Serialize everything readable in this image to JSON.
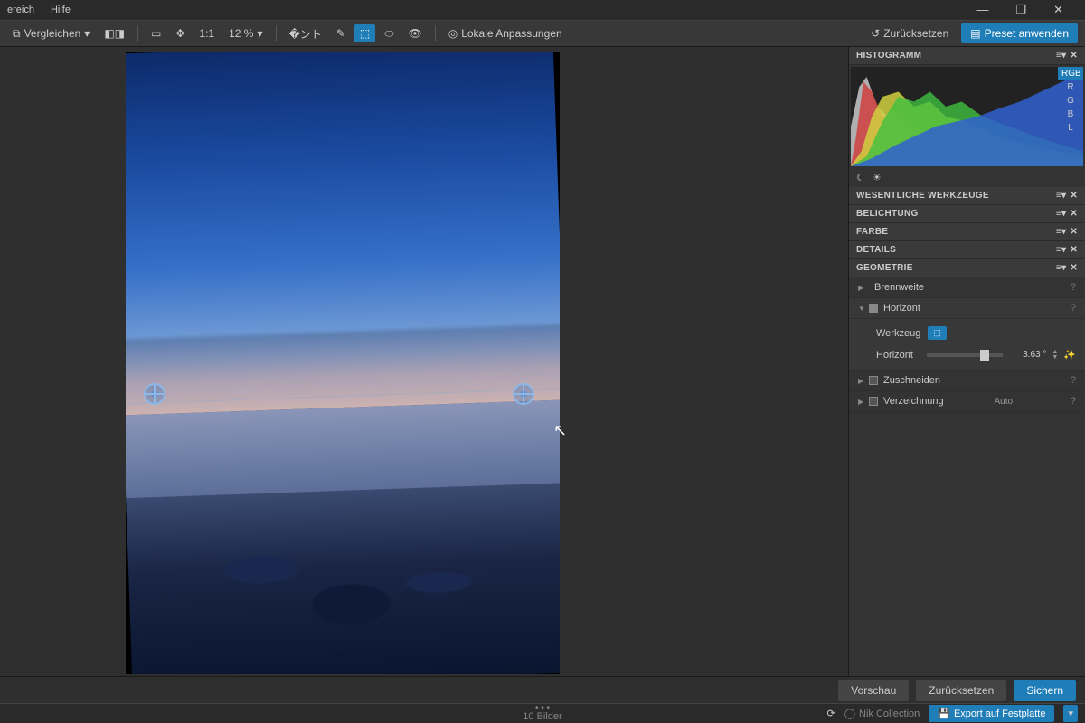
{
  "menu": {
    "bereich": "ereich",
    "hilfe": "Hilfe"
  },
  "window": {
    "min": "—",
    "max": "❐",
    "close": "✕"
  },
  "toolbar": {
    "compare": "Vergleichen",
    "ratio": "1:1",
    "zoom": "12 %",
    "local": "Lokale Anpassungen",
    "reset": "Zurücksetzen",
    "preset": "Preset anwenden"
  },
  "side": {
    "histogram": "HISTOGRAMM",
    "rgb": "RGB",
    "r": "R",
    "g": "G",
    "b": "B",
    "l": "L",
    "panels": {
      "essential": "WESENTLICHE WERKZEUGE",
      "exposure": "BELICHTUNG",
      "color": "FARBE",
      "details": "DETAILS",
      "geometry": "GEOMETRIE"
    },
    "geo": {
      "focal": "Brennweite",
      "horizon": "Horizont",
      "tool_label": "Werkzeug",
      "horizon_label": "Horizont",
      "horizon_value": "3.63 °",
      "crop": "Zuschneiden",
      "distortion": "Verzeichnung",
      "auto": "Auto"
    }
  },
  "bottom": {
    "preview": "Vorschau",
    "reset": "Zurücksetzen",
    "save": "Sichern"
  },
  "status": {
    "count": "10 Bilder",
    "nik": "Nik Collection",
    "export": "Export auf Festplatte"
  }
}
